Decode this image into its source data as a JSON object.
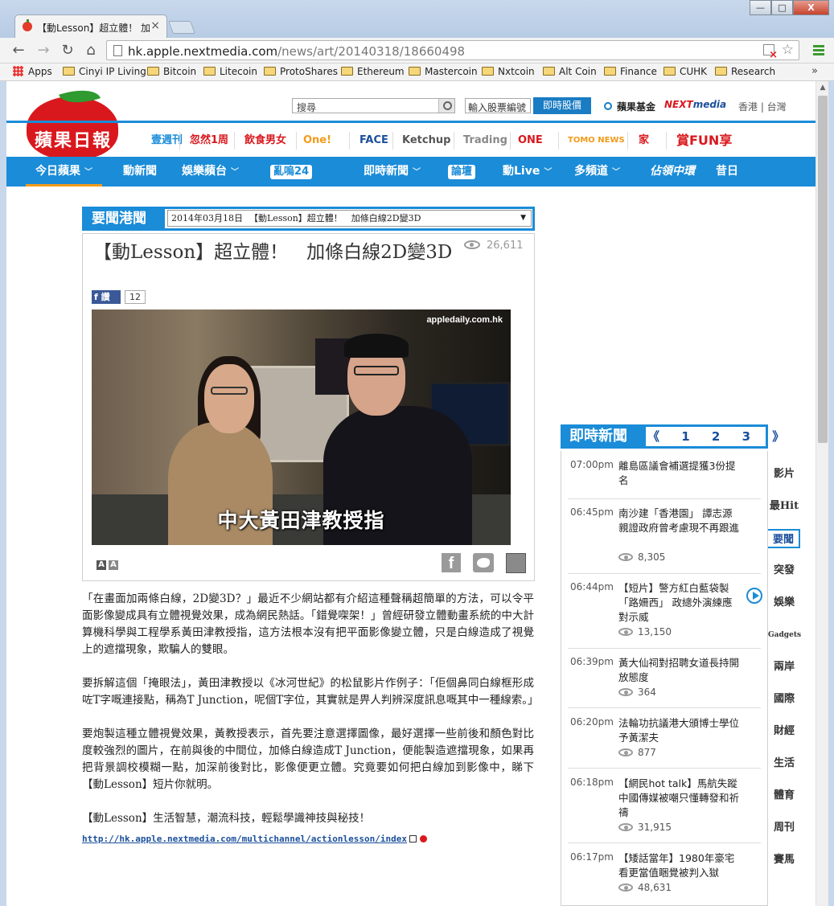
{
  "browser": {
    "tab_title": "【動Lesson】超立體！ 加",
    "url_host": "hk.apple.nextmedia.com",
    "url_path": "/news/art/20140318/18660498",
    "window_buttons": [
      "—",
      "□",
      "X"
    ]
  },
  "bookmarks": [
    "Apps",
    "Cinyi IP Living",
    "Bitcoin",
    "Litecoin",
    "ProtoShares",
    "Ethereum",
    "Mastercoin",
    "Nxtcoin",
    "Alt Coin",
    "Finance",
    "CUHK",
    "Research"
  ],
  "header": {
    "logo_text": "蘋果日報",
    "search_placeholder": "搜尋",
    "stock_placeholder": "輸入股票編號",
    "stock_button": "即時股價",
    "fund_link": "蘋果基金",
    "nextmedia_next": "NEXT",
    "nextmedia_media": "media",
    "regions": "香港 | 台灣"
  },
  "brands": [
    {
      "label": "壹週刊",
      "color": "#1a8cd8"
    },
    {
      "label": "忽然1周",
      "color": "#d9181d"
    },
    {
      "label": "飲食男女",
      "color": "#d9181d"
    },
    {
      "label": "One!",
      "color": "#f39b1a"
    },
    {
      "label": "FACE",
      "color": "#1a4f9c"
    },
    {
      "label": "Ketchup",
      "color": "#555555"
    },
    {
      "label": "Trading",
      "color": "#888888"
    },
    {
      "label": "ONE",
      "color": "#d9181d"
    },
    {
      "label": "TOMO NEWS",
      "color": "#f39b1a"
    },
    {
      "label": "家",
      "color": "#d9181d"
    },
    {
      "label": "賞FUN享",
      "color": "#d9181d"
    }
  ],
  "nav": {
    "items": [
      {
        "label": "今日蘋果",
        "chevron": true,
        "active": true
      },
      {
        "label": "動新聞",
        "chevron": false
      },
      {
        "label": "娛樂蘋台",
        "chevron": true
      },
      {
        "label": "亂嗚24",
        "chevron": false,
        "badge": true
      },
      {
        "label": "即時新聞",
        "chevron": true
      },
      {
        "label": "論壇",
        "chevron": false,
        "badge": true
      },
      {
        "label": "動Live",
        "chevron": true
      },
      {
        "label": "多頻道",
        "chevron": true
      },
      {
        "label": "佔領中環",
        "chevron": false
      },
      {
        "label": "昔日",
        "chevron": false
      }
    ],
    "chevron_glyph": "﹀"
  },
  "section": {
    "label": "要聞港聞",
    "select_date": "2014年03月18日",
    "select_title": "【動Lesson】超立體！　加條白線2D變3D",
    "select_arrow": "▼"
  },
  "article": {
    "headline": "【動Lesson】超立體！　加條白線2D變3D",
    "views": "26,611",
    "fb_label": "讚",
    "fb_count": "12",
    "video_watermark": "appledaily.com.hk",
    "video_subtitle": "中大黃田津教授指",
    "font_small": "A",
    "font_large": "A",
    "share_fb": "f",
    "paragraphs": [
      "「在畫面加兩條白線，2D變3D？」最近不少網站都有介紹這種聲稱超簡單的方法，可以令平面影像變成具有立體視覺效果，成為網民熱話。「錯覺㗎架！」曾經研發立體動畫系統的中大計算機科學與工程學系黃田津教授指，這方法根本沒有把平面影像變立體，只是白線造成了視覺上的遮擋現象，欺騙人的雙眼。",
      "要拆解這個「掩眼法」，黃田津教授以《冰河世紀》的松鼠影片作例子：「佢個鼻同白線框形成咗T字嘅連接點，稱為T Junction，呢個T字位，其實就是畀人判辨深度訊息嘅其中一種線索。」",
      "要炮製這種立體視覺效果，黃教授表示，首先要注意選擇圖像，最好選擇一些前後和顏色對比度較強烈的圖片，在前與後的中間位，加條白線造成T Junction，便能製造遮擋現象，如果再把背景調校模糊一點，加深前後對比，影像便更立體。究竟要如何把白線加到影像中，睇下【動Lesson】短片你就明。",
      "【動Lesson】生活智慧，潮流科技，輕鬆學識神技與秘技！"
    ],
    "link": "http://hk.apple.nextmedia.com/multichannel/actionlesson/index"
  },
  "news": {
    "label": "即時新聞",
    "prev": "《",
    "pages": [
      "1",
      "2",
      "3"
    ],
    "next": "》",
    "items": [
      {
        "time": "07:00pm",
        "title": "離島區議會補選提獲3份提名",
        "count": ""
      },
      {
        "time": "06:45pm",
        "title": "南沙建「香港園」 譚志源親證政府曾考慮現不再跟進",
        "count": "8,305"
      },
      {
        "time": "06:44pm",
        "title": "【短片】警方紅白藍袋製「路姍西」 政總外演練應對示威",
        "count": "13,150",
        "video": true
      },
      {
        "time": "06:39pm",
        "title": "黃大仙祠對招聘女道長持開放態度",
        "count": "364"
      },
      {
        "time": "06:20pm",
        "title": "法輪功抗議港大頒博士學位予黃潔夫",
        "count": "877"
      },
      {
        "time": "06:18pm",
        "title": "【網民hot talk】馬航失蹤中國傳媒被嘲只懂轉發和祈禱",
        "count": "31,915"
      },
      {
        "time": "06:17pm",
        "title": "【矮話當年】1980年豪宅看更當值睏覺被判入獄",
        "count": "48,631"
      }
    ]
  },
  "categories": [
    "影片",
    "最Hit",
    "要聞",
    "突發",
    "娛樂",
    "Gadgets",
    "兩岸",
    "國際",
    "財經",
    "生活",
    "體育",
    "周刊",
    "賽馬"
  ]
}
